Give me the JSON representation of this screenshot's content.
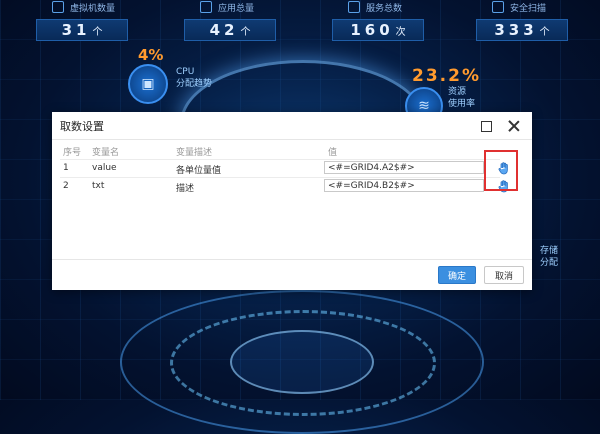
{
  "dashboard": {
    "stats": [
      {
        "label": "虚拟机数量",
        "value": "31",
        "unit": "个"
      },
      {
        "label": "应用总量",
        "value": "42",
        "unit": "个"
      },
      {
        "label": "服务总数",
        "value": "160",
        "unit": "次"
      },
      {
        "label": "安全扫描",
        "value": "333",
        "unit": "个"
      }
    ],
    "cpu": {
      "percent": "4%",
      "label_line1": "CPU",
      "label_line2": "分配趋势"
    },
    "resource": {
      "percent": "23.2%",
      "label_line1": "资源",
      "label_line2": "使用率"
    },
    "storage": {
      "label_line1": "存储",
      "label_line2": "分配"
    }
  },
  "dialog": {
    "title": "取数设置",
    "columns": {
      "seq": "序号",
      "name": "变量名",
      "desc": "变量描述",
      "value": "值"
    },
    "rows": [
      {
        "seq": "1",
        "name": "value",
        "desc": "各单位量值",
        "value": "<#=GRID4.A2$#>"
      },
      {
        "seq": "2",
        "name": "txt",
        "desc": "描述",
        "value": "<#=GRID4.B2$#>"
      }
    ],
    "ok_label": "确定",
    "cancel_label": "取消"
  },
  "colors": {
    "accent": "#3b8fe0",
    "highlight": "#e03030",
    "orange": "#ff9a2e"
  }
}
